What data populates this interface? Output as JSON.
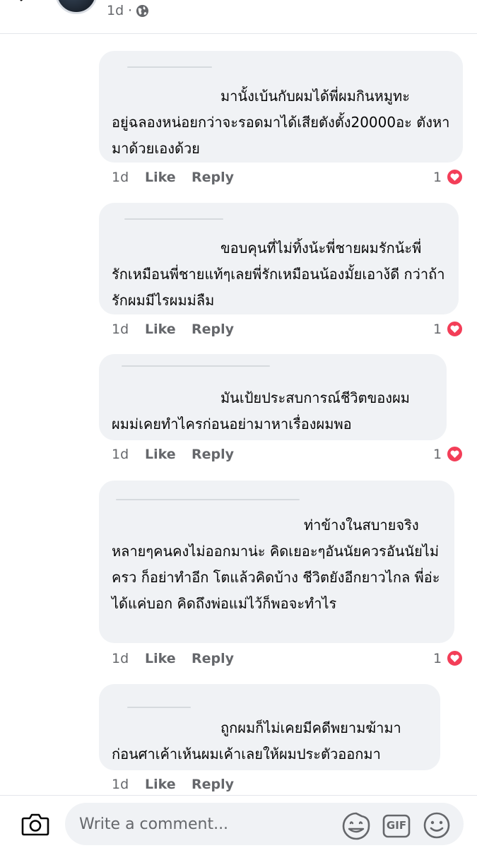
{
  "post": {
    "time": "1d",
    "separator": "·"
  },
  "comments": [
    {
      "first_line": "มานั้งเบ้นกับผมได้พี่ผมกินหมูทะ",
      "rest": "อยู่ฉลองหน่อยกว่าจะรอดมาได้เสียตังตั้ง20000อะ ตังหามาด้วยเองด้วย",
      "time": "1d",
      "like": "Like",
      "reply": "Reply",
      "reactions": "1"
    },
    {
      "first_line": "ขอบคุนที่ไม่ทิ้งน้ะพี่ชายผมรักน้ะพี่",
      "rest": "รักเหมือนพี่ชายแท้ๆเลยพี่รักเหมือนน้องมั้ยเอาง้ดี กว่าถ้ารักผมมีไรผมม่ลืม",
      "time": "1d",
      "like": "Like",
      "reply": "Reply",
      "reactions": "1"
    },
    {
      "first_line": "มันเป้ยประสบการณ์ชีวิตของผม",
      "rest": "ผมม่เคยทำไครก่อนอย่ามาหาเรื่องผมพอ",
      "time": "1d",
      "like": "Like",
      "reply": "Reply",
      "reactions": "1"
    },
    {
      "first_line": "ท่าข้างในสบายจริง",
      "rest": "หลายๆคนคงไม่ออกมาน่ะ คิดเยอะๆอันนัยควรอันนัยไม่ครว ก็อย่าทำอีก โตแล้วคิดบ้าง ชีวิตยังอีกยาวไกล พี่อ่ะได้แค่บอก คิดถึงพ่อแม่ไว้ก็พอจะทำไร",
      "time": "1d",
      "like": "Like",
      "reply": "Reply",
      "reactions": "1"
    },
    {
      "first_line": "ถูกผมก็ไม่เคยมีคดีพยามฆ้ามา",
      "rest": "ก่อนศาเค้าเห้นผมเค้าเลยให้ผมประตัวออกมา",
      "time": "1d",
      "like": "Like",
      "reply": "Reply"
    }
  ],
  "composer": {
    "placeholder": "Write a comment...",
    "gif_label": "GIF"
  },
  "colors": {
    "heart": "#f33e58",
    "bubble": "#f0f2f5",
    "meta": "#65676b"
  },
  "icons": [
    "back-arrow-icon",
    "globe-icon",
    "heart-icon",
    "camera-icon",
    "sticker-icon",
    "gif-icon",
    "emoji-icon"
  ]
}
